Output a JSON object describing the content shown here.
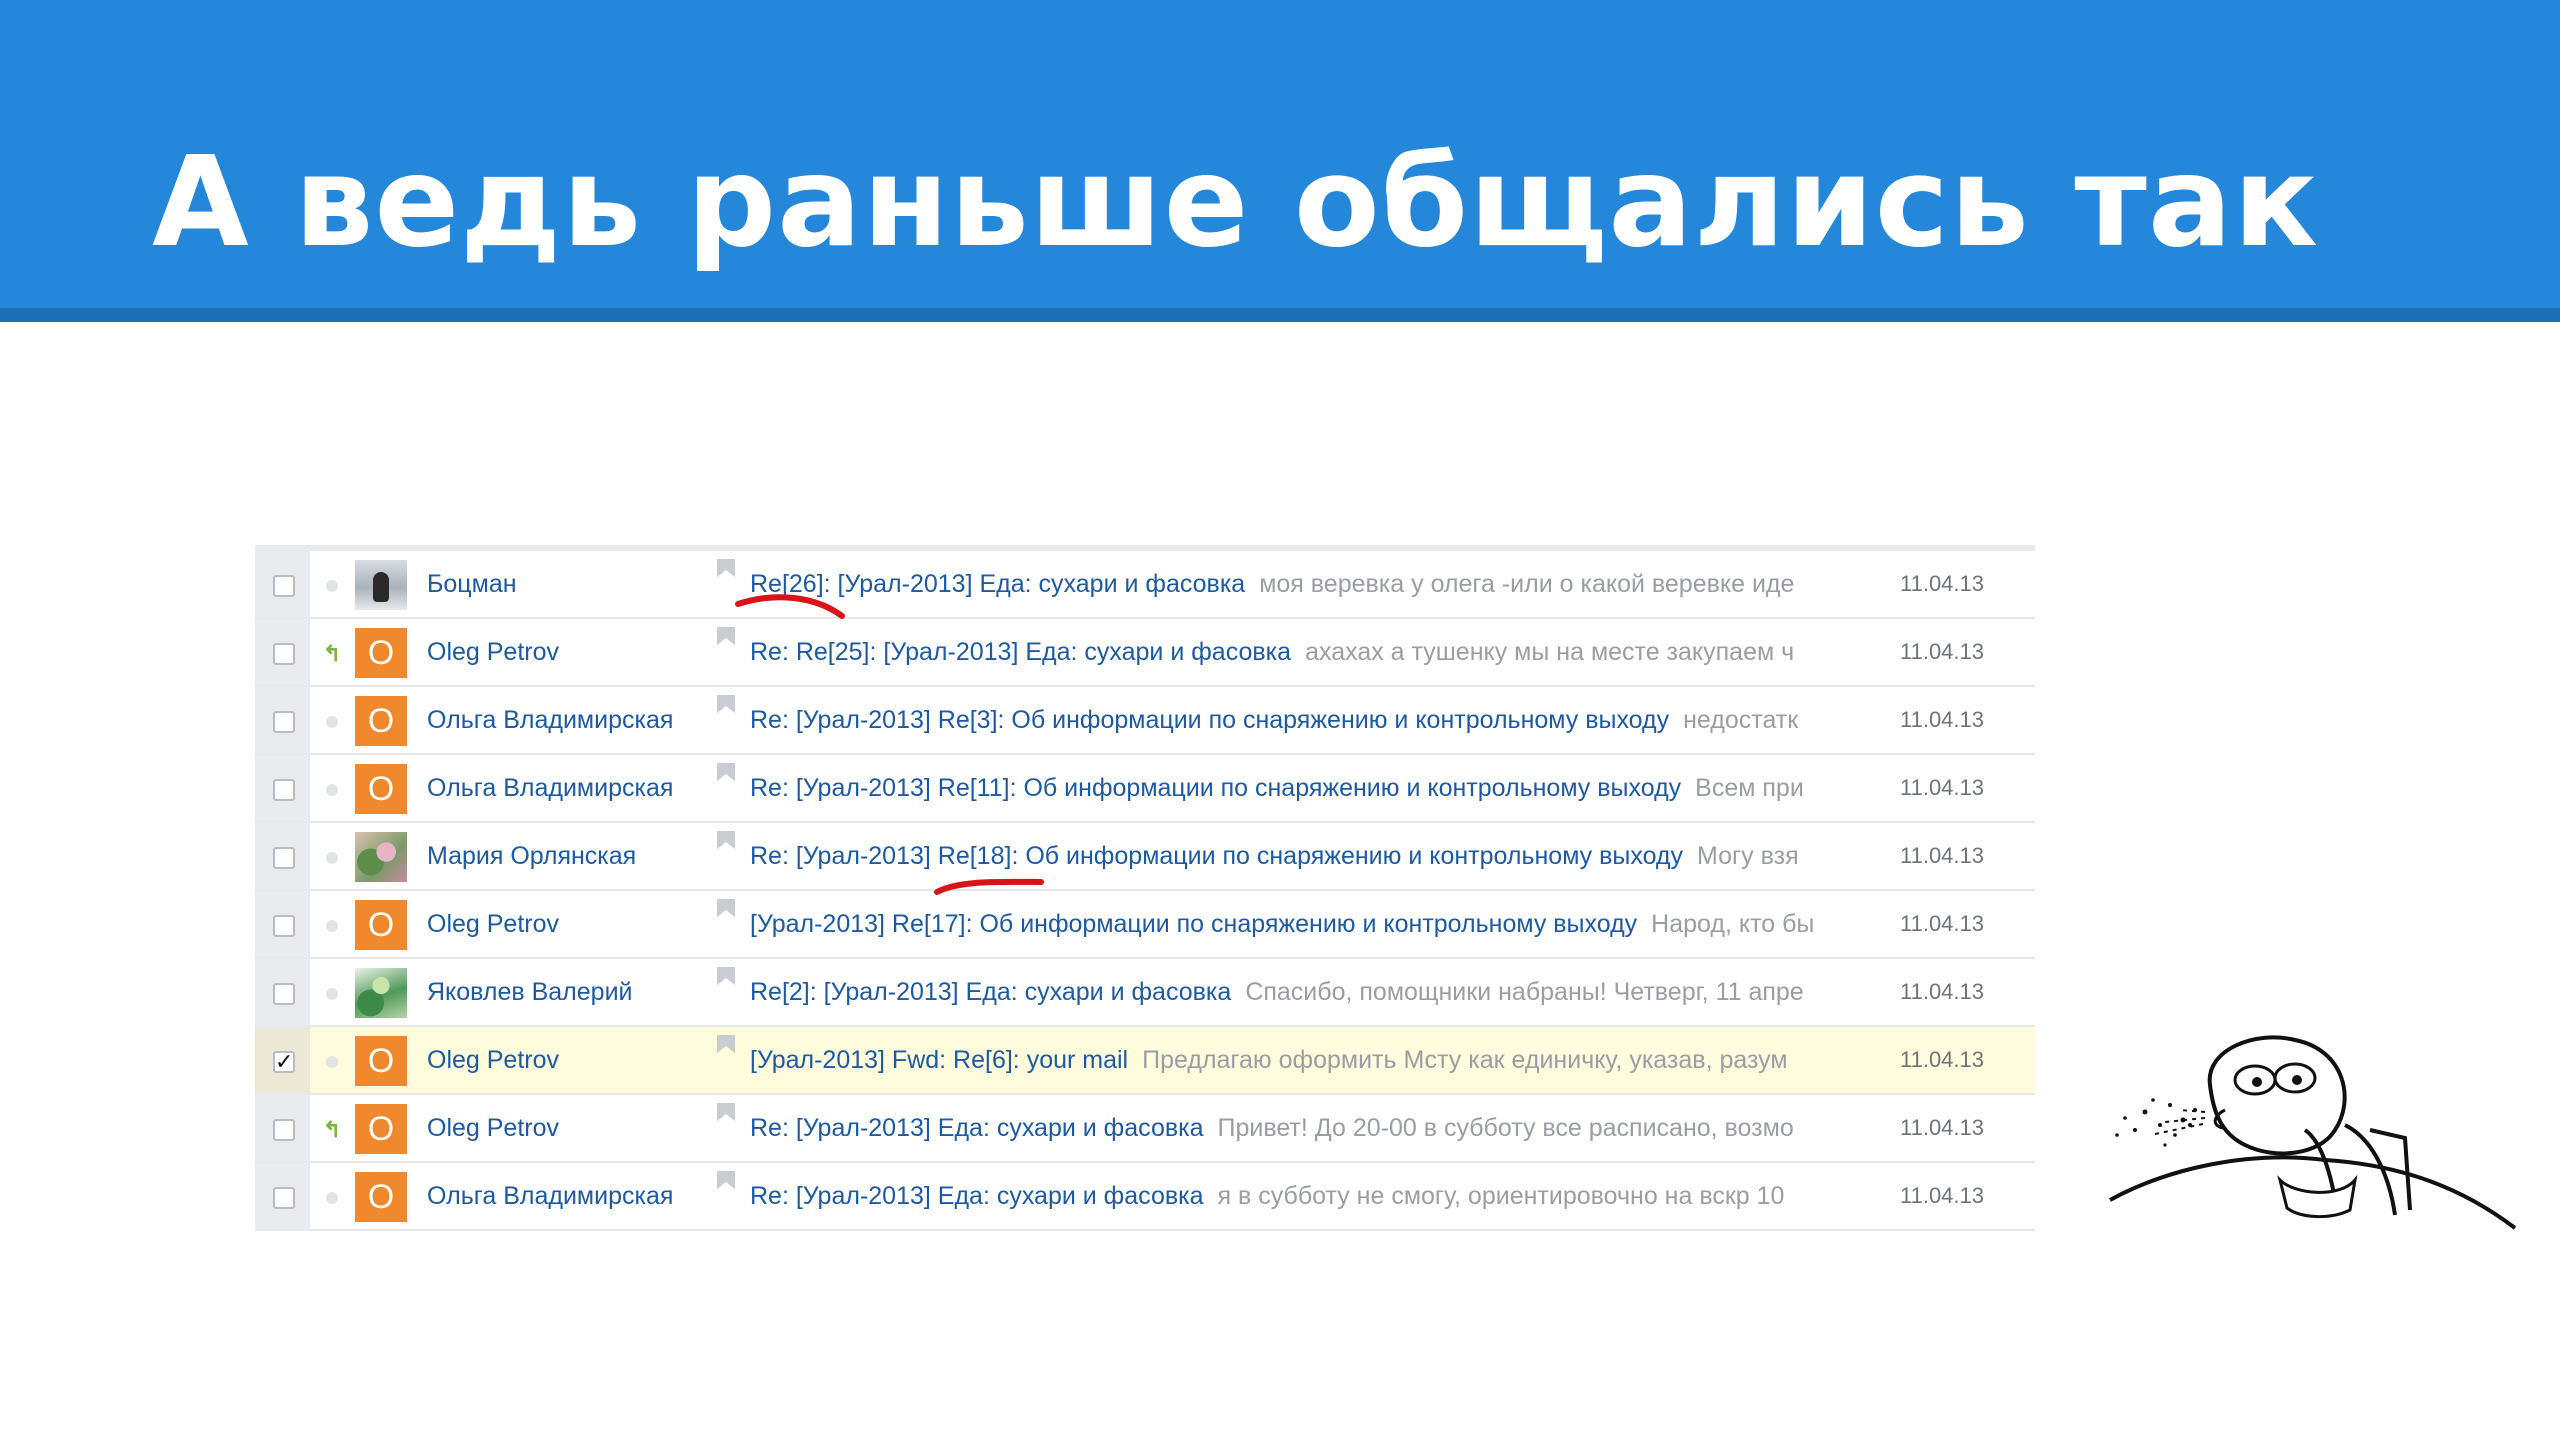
{
  "slide": {
    "title": "А ведь раньше общались так",
    "header_color": "#2587d9"
  },
  "mail_list": {
    "link_color": "#1e5aa3",
    "snippet_color": "#9a9ea4",
    "selected_row_color": "#fffbdd",
    "avatar_color": "#f0892d",
    "rows": [
      {
        "checked": false,
        "status": "dot",
        "avatar": "photo1",
        "avatar_letter": "",
        "sender": "Боцман",
        "subject": "Re[26]: [Урал-2013] Еда: сухари и фасовка",
        "snippet": "моя веревка у олега -или о какой веревке иде",
        "date": "11.04.13"
      },
      {
        "checked": false,
        "status": "reply-arrow-icon",
        "avatar": "letter",
        "avatar_letter": "O",
        "sender": "Oleg Petrov",
        "subject": "Re: Re[25]: [Урал-2013] Еда: сухари и фасовка",
        "snippet": "ахахах а тушенку мы на месте закупаем ч",
        "date": "11.04.13"
      },
      {
        "checked": false,
        "status": "dot",
        "avatar": "letter",
        "avatar_letter": "O",
        "sender": "Ольга Владимирская",
        "subject": "Re: [Урал-2013] Re[3]: Об информации по снаряжению и контрольному выходу",
        "snippet": "недостатк",
        "date": "11.04.13"
      },
      {
        "checked": false,
        "status": "dot",
        "avatar": "letter",
        "avatar_letter": "O",
        "sender": "Ольга Владимирская",
        "subject": "Re: [Урал-2013] Re[11]: Об информации по снаряжению и контрольному выходу",
        "snippet": "Всем при",
        "date": "11.04.13"
      },
      {
        "checked": false,
        "status": "dot",
        "avatar": "photo2",
        "avatar_letter": "",
        "sender": "Мария Орлянская",
        "subject": "Re: [Урал-2013] Re[18]: Об информации по снаряжению и контрольному выходу",
        "snippet": "Могу взя",
        "date": "11.04.13"
      },
      {
        "checked": false,
        "status": "dot",
        "avatar": "letter",
        "avatar_letter": "O",
        "sender": "Oleg Petrov",
        "subject": "[Урал-2013] Re[17]: Об информации по снаряжению и контрольному выходу",
        "snippet": "Народ, кто бы",
        "date": "11.04.13"
      },
      {
        "checked": false,
        "status": "dot",
        "avatar": "photo3",
        "avatar_letter": "",
        "sender": "Яковлев Валерий",
        "subject": "Re[2]: [Урал-2013] Еда: сухари и фасовка",
        "snippet": "Спасибо, помощники набраны! Четверг, 11 апре",
        "date": "11.04.13"
      },
      {
        "checked": true,
        "status": "dot",
        "avatar": "letter",
        "avatar_letter": "O",
        "sender": "Oleg Petrov",
        "subject": "[Урал-2013] Fwd: Re[6]: your mail",
        "snippet": "Предлагаю оформить Мсту как единичку, указав, разум",
        "date": "11.04.13"
      },
      {
        "checked": false,
        "status": "reply-arrow-icon",
        "avatar": "letter",
        "avatar_letter": "O",
        "sender": "Oleg Petrov",
        "subject": "Re: [Урал-2013] Еда: сухари и фасовка",
        "snippet": "Привет! До 20-00 в субботу все расписано, возмо",
        "date": "11.04.13"
      },
      {
        "checked": false,
        "status": "dot",
        "avatar": "letter",
        "avatar_letter": "O",
        "sender": "Ольга Владимирская",
        "subject": "Re: [Урал-2013] Еда: сухари и фасовка",
        "snippet": "я в субботу не смогу, ориентировочно на вскр 10",
        "date": "11.04.13"
      }
    ]
  },
  "annotations": {
    "underline_color": "#d8141a"
  }
}
